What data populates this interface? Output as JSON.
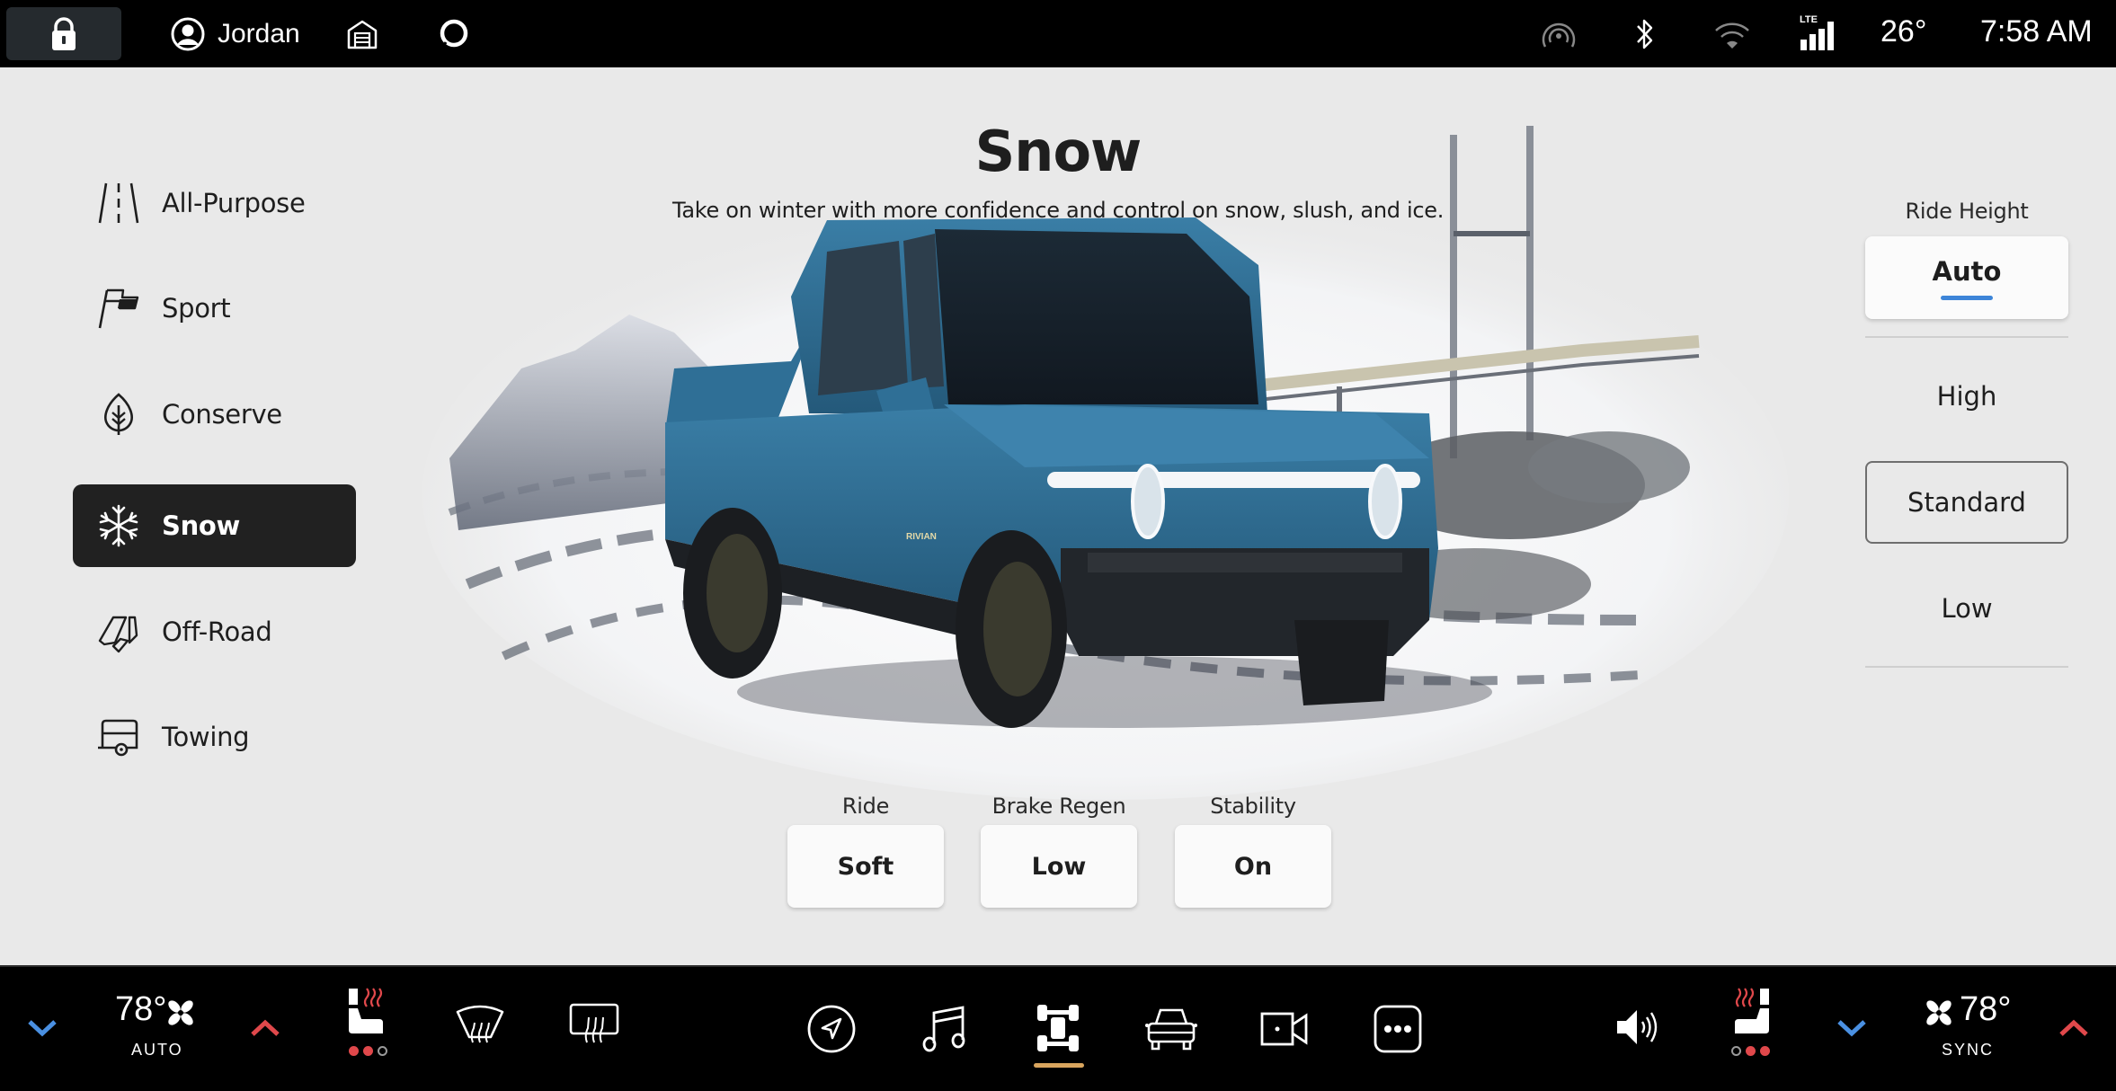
{
  "status_bar": {
    "lock_icon": "lock-icon",
    "user": {
      "icon": "user-avatar-icon",
      "name": "Jordan"
    },
    "garage_icon": "garage-icon",
    "assistant_icon": "voice-assistant-icon",
    "indicators": [
      "remote-connection-icon",
      "bluetooth-icon",
      "wifi-icon",
      "lte-signal-icon"
    ],
    "lte_label": "LTE",
    "outside_temp": "26°",
    "time": "7:58 AM"
  },
  "drive_modes": {
    "selected": "Snow",
    "items": [
      {
        "label": "All-Purpose",
        "icon": "road-icon"
      },
      {
        "label": "Sport",
        "icon": "flag-icon"
      },
      {
        "label": "Conserve",
        "icon": "leaf-icon"
      },
      {
        "label": "Snow",
        "icon": "snowflake-icon"
      },
      {
        "label": "Off-Road",
        "icon": "off-road-icon"
      },
      {
        "label": "Towing",
        "icon": "trailer-icon"
      }
    ]
  },
  "hero": {
    "title": "Snow",
    "description": "Take on winter with more confidence and control on snow, slush, and ice.",
    "vehicle_badge": "RIVIAN"
  },
  "mode_settings": [
    {
      "label": "Ride",
      "value": "Soft"
    },
    {
      "label": "Brake Regen",
      "value": "Low"
    },
    {
      "label": "Stability",
      "value": "On"
    }
  ],
  "ride_height": {
    "title": "Ride Height",
    "selected": "Auto",
    "current": "Standard",
    "options": [
      "Auto",
      "High",
      "Standard",
      "Low"
    ]
  },
  "climate": {
    "driver": {
      "temp": "78°",
      "mode": "AUTO",
      "seat_heat_level": 2,
      "seat_heat_max": 3
    },
    "passenger": {
      "temp": "78°",
      "mode": "SYNC",
      "seat_heat_level": 2,
      "seat_heat_max": 3
    }
  },
  "nav_bar": {
    "active": "vehicle-dynamics",
    "items": [
      "navigation-icon",
      "music-icon",
      "vehicle-dynamics-icon",
      "vehicle-icon",
      "camera-icon",
      "more-icon"
    ]
  },
  "colors": {
    "temp_down": "#4a90e2",
    "temp_up": "#e0484b",
    "heat_active": "#e0484b",
    "nav_active_indicator": "#d9a55e",
    "ride_height_indicator": "#3d85d8",
    "vehicle_body": "#2e6d93"
  }
}
